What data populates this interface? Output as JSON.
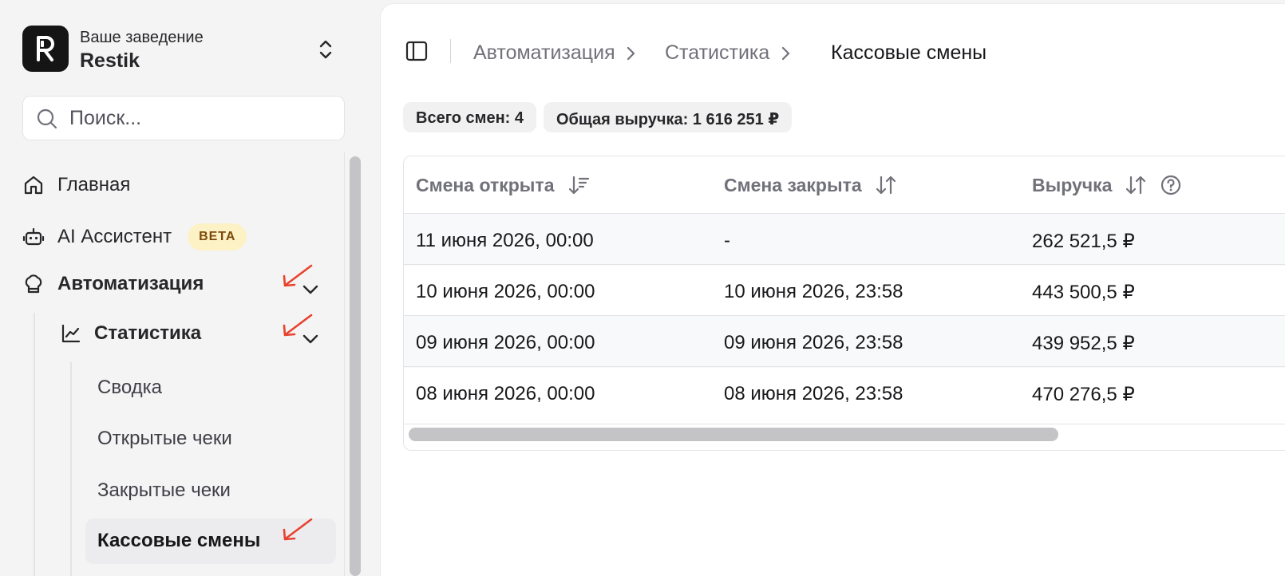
{
  "brand": {
    "subtitle": "Ваше заведение",
    "name": "Restik",
    "logo_letter": "R"
  },
  "search": {
    "placeholder": "Поиск..."
  },
  "nav": {
    "home": "Главная",
    "ai": "AI Ассистент",
    "ai_badge": "BETA",
    "automation": "Автоматизация",
    "statistics": "Статистика",
    "sub_items": [
      "Сводка",
      "Открытые чеки",
      "Закрытые чеки",
      "Кассовые смены"
    ]
  },
  "breadcrumb": [
    "Автоматизация",
    "Статистика",
    "Кассовые смены"
  ],
  "summary": {
    "total_shifts": "Всего смен: 4",
    "total_revenue": "Общая выручка: 1 616 251 ₽"
  },
  "table": {
    "columns": [
      "Смена открыта",
      "Смена закрыта",
      "Выручка"
    ],
    "rows": [
      [
        "11 июня 2026, 00:00",
        "-",
        "262 521,5 ₽"
      ],
      [
        "10 июня 2026, 00:00",
        "10 июня 2026, 23:58",
        "443 500,5 ₽"
      ],
      [
        "09 июня 2026, 00:00",
        "09 июня 2026, 23:58",
        "439 952,5 ₽"
      ],
      [
        "08 июня 2026, 00:00",
        "08 июня 2026, 23:58",
        "470 276,5 ₽"
      ]
    ]
  },
  "colors": {
    "annotation_arrow": "#e8432f",
    "beta_bg": "#fdf1c6",
    "beta_text": "#7c4a0a"
  },
  "icons": {
    "home": "house-icon",
    "ai": "robot-icon",
    "automation": "chef-hat-icon",
    "statistics": "line-chart-icon",
    "panel": "sidebar-panel-icon",
    "sort_desc": "sort-descending-icon",
    "sort": "sort-arrows-icon",
    "help": "question-circle-icon"
  }
}
